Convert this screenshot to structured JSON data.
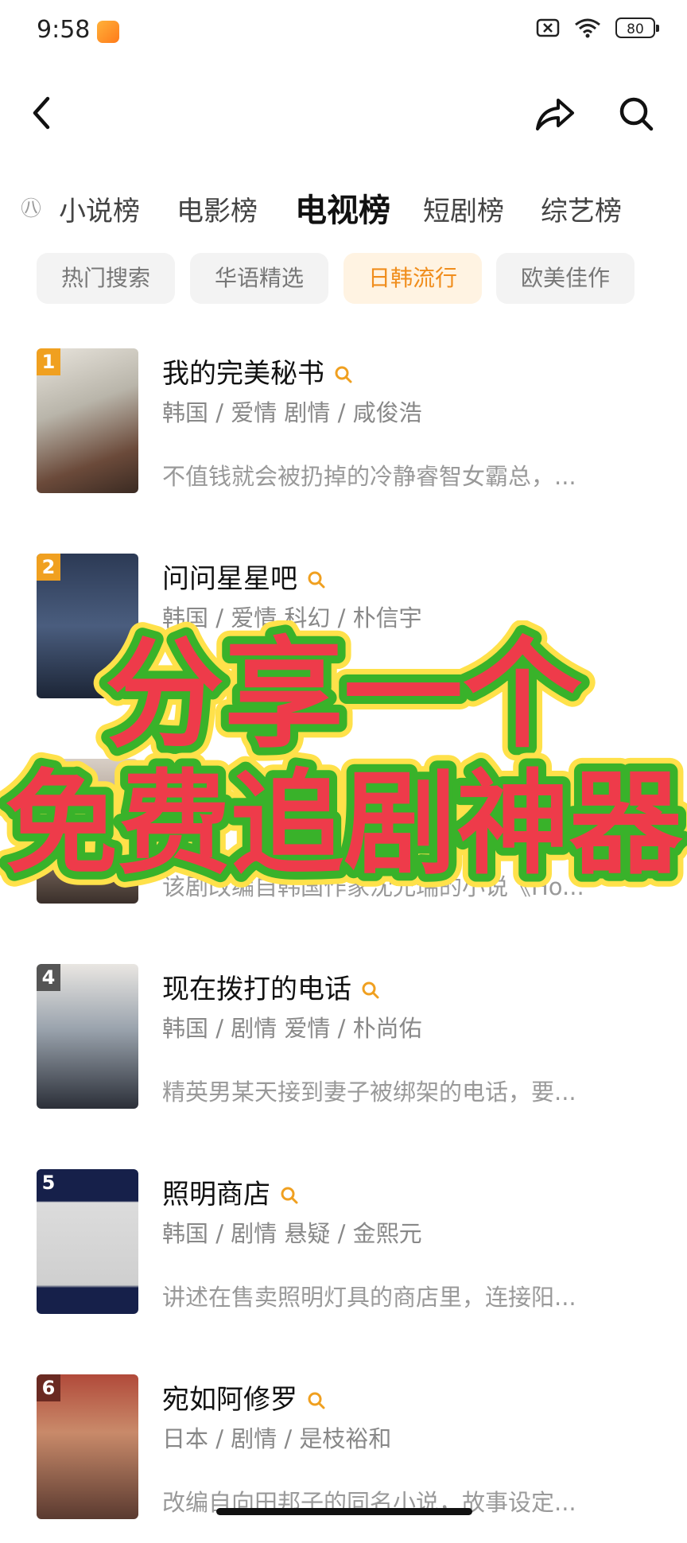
{
  "status_bar": {
    "time": "9:58",
    "battery": "80"
  },
  "tabs": {
    "left_edge": "㊇",
    "items": [
      "小说榜",
      "电影榜",
      "电视榜",
      "短剧榜",
      "综艺榜"
    ],
    "active": "电视榜"
  },
  "chips": {
    "items": [
      "热门搜索",
      "华语精选",
      "日韩流行",
      "欧美佳作"
    ],
    "active": "日韩流行"
  },
  "list": [
    {
      "rank": "1",
      "title": "我的完美秘书",
      "meta": "韩国 / 爱情 剧情 / 咸俊浩",
      "desc": "不值钱就会被扔掉的冷静睿智女霸总，..."
    },
    {
      "rank": "2",
      "title": "问问星星吧",
      "meta": "韩国 / 爱情 科幻 / 朴信宇",
      "desc": ""
    },
    {
      "rank": "3",
      "title": "",
      "meta": "",
      "desc": "该剧改编自韩国作家沈允瑞的小说《Ho..."
    },
    {
      "rank": "4",
      "title": "现在拨打的电话",
      "meta": "韩国 / 剧情 爱情 / 朴尚佑",
      "desc": "精英男某天接到妻子被绑架的电话，要..."
    },
    {
      "rank": "5",
      "title": "照明商店",
      "meta": "韩国 / 剧情 悬疑 / 金熙元",
      "desc": "讲述在售卖照明灯具的商店里，连接阳..."
    },
    {
      "rank": "6",
      "title": "宛如阿修罗",
      "meta": "日本 / 剧情 / 是枝裕和",
      "desc": "改编自向田邦子的同名小说，故事设定..."
    }
  ],
  "overlay": {
    "line1": "分享一个",
    "line2": "免费追剧神器"
  },
  "colors": {
    "accent": "#f08d1c",
    "overlay_fill": "#ee3b4a",
    "overlay_stroke": "#39b22a"
  }
}
